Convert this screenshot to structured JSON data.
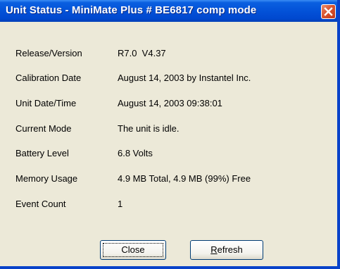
{
  "window": {
    "title": "Unit Status - MiniMate Plus # BE6817 comp mode"
  },
  "fields": [
    {
      "label": "Release/Version",
      "value": "R7.0  V4.37"
    },
    {
      "label": "Calibration Date",
      "value": "August 14, 2003 by Instantel Inc."
    },
    {
      "label": "Unit Date/Time",
      "value": "August 14, 2003 09:38:01"
    },
    {
      "label": "Current Mode",
      "value": "The unit is idle."
    },
    {
      "label": "Battery Level",
      "value": "6.8 Volts"
    },
    {
      "label": "Memory Usage",
      "value": "4.9 MB Total, 4.9 MB (99%) Free"
    },
    {
      "label": "Event Count",
      "value": "1"
    }
  ],
  "buttons": {
    "close_label": "Close",
    "refresh_first": "R",
    "refresh_rest": "efresh"
  },
  "icons": {
    "close": "close-x-icon"
  },
  "colors": {
    "titlebar": "#0352d8",
    "dialog_bg": "#ece9d8",
    "close_button": "#d9542f"
  }
}
